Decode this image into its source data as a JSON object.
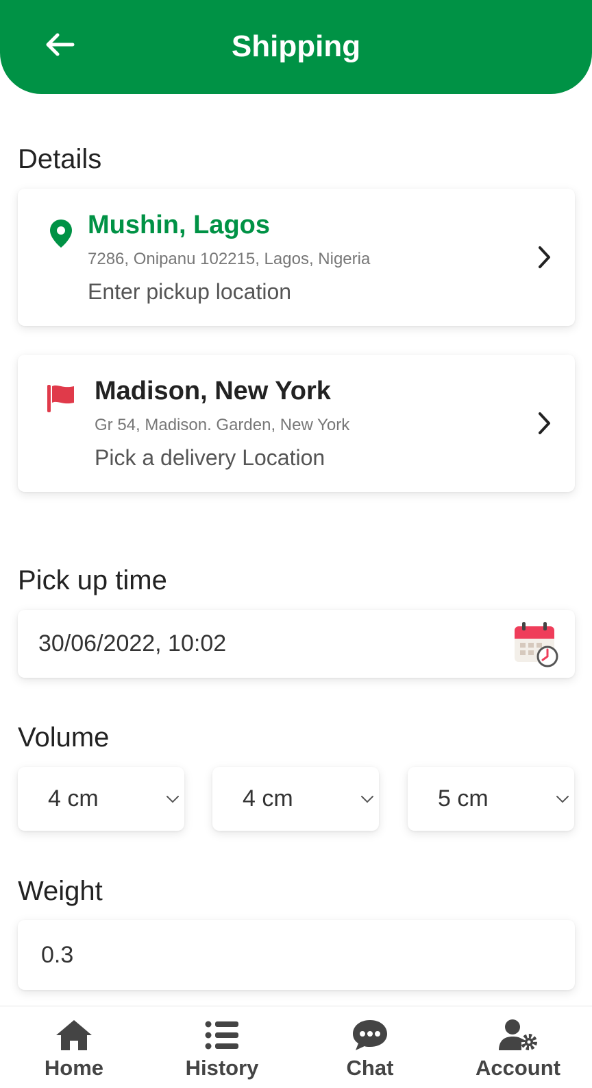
{
  "header": {
    "title": "Shipping",
    "back_icon": "arrow-left-icon",
    "background_color": "#009245"
  },
  "details": {
    "section_title": "Details",
    "pickup": {
      "name": "Mushin, Lagos",
      "address": "7286, Onipanu 102215, Lagos, Nigeria",
      "hint": "Enter pickup location",
      "icon": "map-pin-icon",
      "name_color": "#009245"
    },
    "delivery": {
      "name": "Madison, New York",
      "address": "Gr 54, Madison. Garden, New York",
      "hint": "Pick a delivery Location",
      "icon": "flag-icon",
      "icon_color": "#e03a4a"
    }
  },
  "pickup_time": {
    "section_title": "Pick up time",
    "value": "30/06/2022, 10:02",
    "icon": "calendar-clock-icon"
  },
  "volume": {
    "section_title": "Volume",
    "fields": [
      {
        "value": "4 cm"
      },
      {
        "value": "4 cm"
      },
      {
        "value": "5 cm"
      }
    ]
  },
  "weight": {
    "section_title": "Weight",
    "value": "0.3"
  },
  "bottom_nav": {
    "items": [
      {
        "label": "Home",
        "icon": "home-icon"
      },
      {
        "label": "History",
        "icon": "list-icon"
      },
      {
        "label": "Chat",
        "icon": "chat-bubble-icon"
      },
      {
        "label": "Account",
        "icon": "user-settings-icon"
      }
    ]
  }
}
